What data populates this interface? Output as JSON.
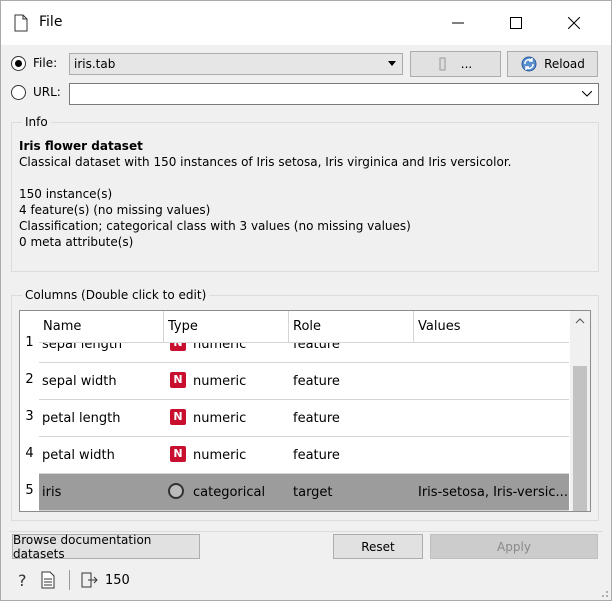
{
  "window": {
    "title": "File"
  },
  "file_row": {
    "label": "File:",
    "selected_file": "iris.tab",
    "browse_label": "...",
    "reload_label": "Reload"
  },
  "url_row": {
    "label": "URL:",
    "value": ""
  },
  "info": {
    "group_title": "Info",
    "dataset_name": "Iris flower dataset",
    "description": "Classical dataset with 150 instances of Iris setosa, Iris virginica and Iris versicolor.",
    "stats": [
      "150 instance(s)",
      "4 feature(s) (no missing values)",
      "Classification; categorical class with 3 values (no missing values)",
      "0 meta attribute(s)"
    ]
  },
  "columns": {
    "group_title": "Columns (Double click to edit)",
    "headers": [
      "Name",
      "Type",
      "Role",
      "Values"
    ],
    "rows": [
      {
        "num": "1",
        "name": "sepal length",
        "type": "numeric",
        "type_icon": "N",
        "role": "feature",
        "values": ""
      },
      {
        "num": "2",
        "name": "sepal width",
        "type": "numeric",
        "type_icon": "N",
        "role": "feature",
        "values": ""
      },
      {
        "num": "3",
        "name": "petal length",
        "type": "numeric",
        "type_icon": "N",
        "role": "feature",
        "values": ""
      },
      {
        "num": "4",
        "name": "petal width",
        "type": "numeric",
        "type_icon": "N",
        "role": "feature",
        "values": ""
      },
      {
        "num": "5",
        "name": "iris",
        "type": "categorical",
        "type_icon": "categorical-icon",
        "role": "target",
        "values": "Iris-setosa, Iris-versic..."
      }
    ]
  },
  "buttons": {
    "browse_docs": "Browse documentation datasets",
    "reset": "Reset",
    "apply": "Apply"
  },
  "status_bar": {
    "output_count": "150"
  },
  "colors": {
    "numeric_badge": "#c8102e",
    "selected_row": "#9c9c9c"
  }
}
